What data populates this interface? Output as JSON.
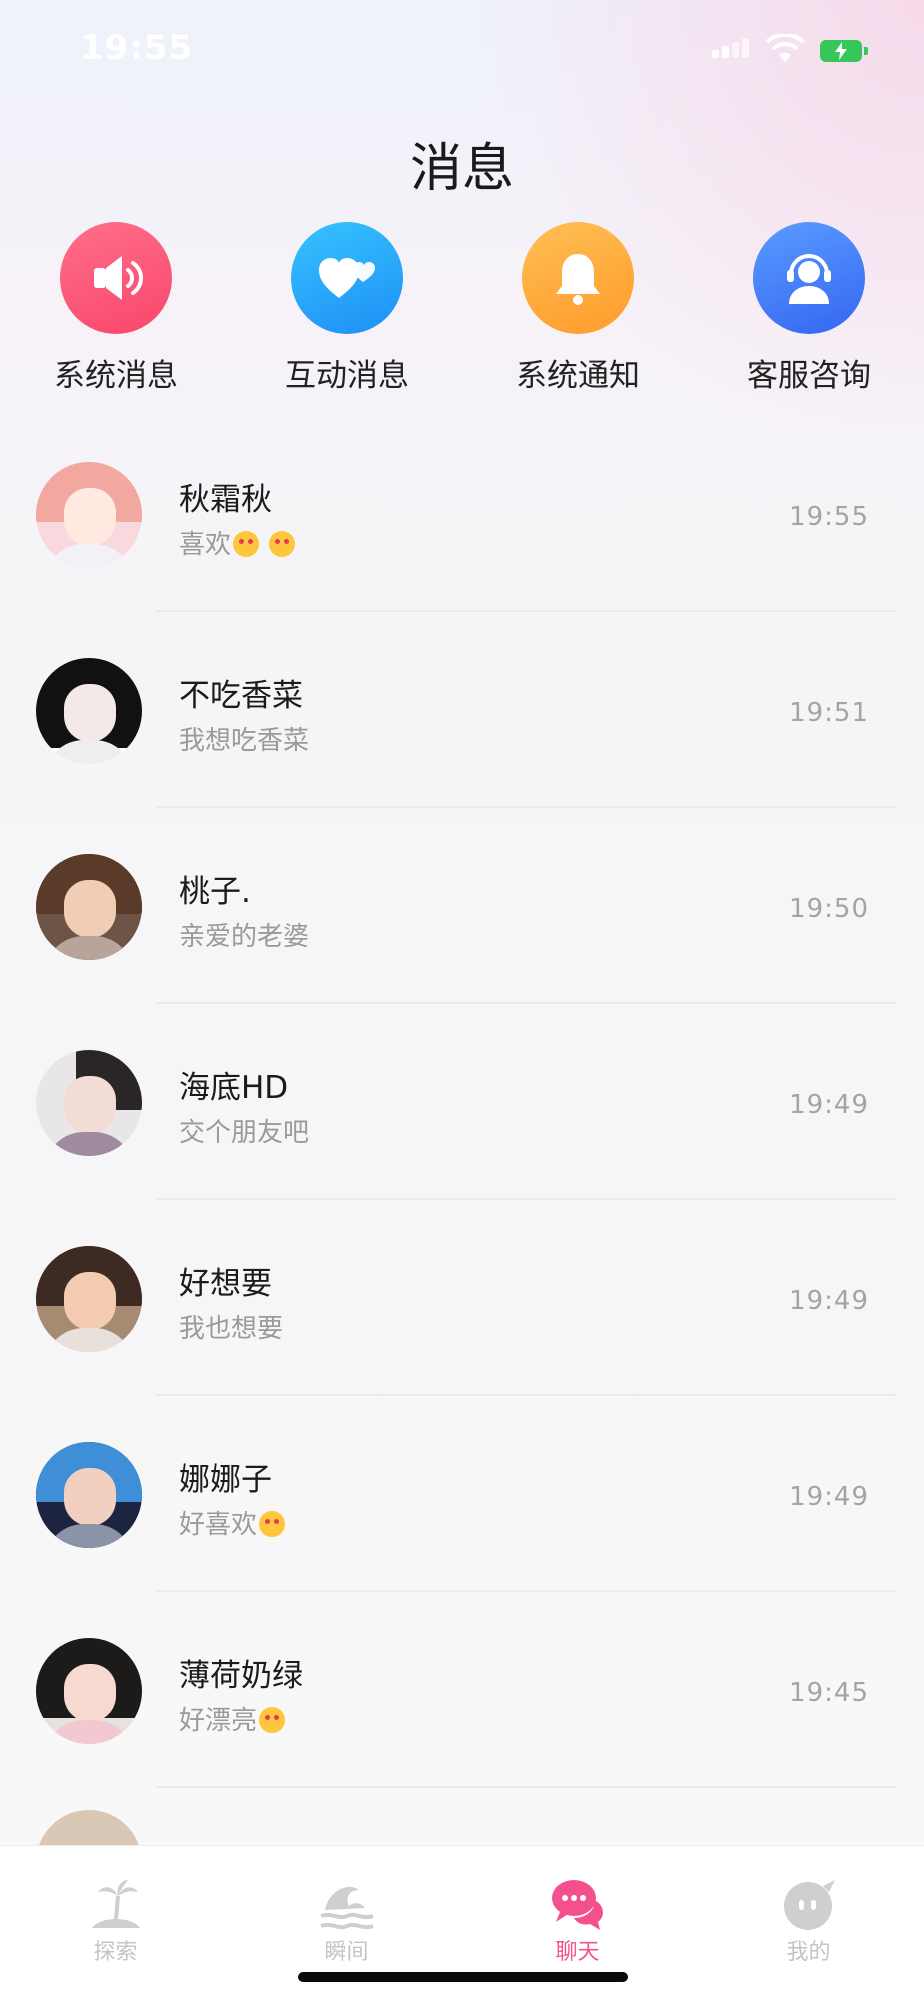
{
  "status_bar": {
    "time": "19:55"
  },
  "header": {
    "title": "消息"
  },
  "quick_actions": [
    {
      "label": "系统消息",
      "icon": "speaker-icon",
      "color": "#f9466b"
    },
    {
      "label": "互动消息",
      "icon": "hearts-icon",
      "color": "#1d8ff5"
    },
    {
      "label": "系统通知",
      "icon": "bell-icon",
      "color": "#ff9b2c"
    },
    {
      "label": "客服咨询",
      "icon": "headset-agent-icon",
      "color": "#3466f2"
    }
  ],
  "chats": [
    {
      "name": "秋霜秋",
      "message": "喜欢",
      "emoji": "kiss-heart-eyes-emoji",
      "time": "19:55"
    },
    {
      "name": "不吃香菜",
      "message": "我想吃香菜",
      "time": "19:51"
    },
    {
      "name": "桃子.",
      "message": "亲爱的老婆",
      "time": "19:50"
    },
    {
      "name": "海底HD",
      "message": "交个朋友吧",
      "time": "19:49"
    },
    {
      "name": "好想要",
      "message": "我也想要",
      "time": "19:49"
    },
    {
      "name": "娜娜子",
      "message": "好喜欢",
      "emoji": "heart-eyes-emoji",
      "time": "19:49"
    },
    {
      "name": "薄荷奶绿",
      "message": "好漂亮",
      "emoji": "heart-eyes-emoji",
      "time": "19:45"
    }
  ],
  "tab_bar": {
    "tabs": [
      {
        "label": "探索",
        "icon": "palm-island-icon"
      },
      {
        "label": "瞬间",
        "icon": "wave-icon"
      },
      {
        "label": "聊天",
        "icon": "chat-bubbles-icon",
        "active": true
      },
      {
        "label": "我的",
        "icon": "profile-bubble-icon"
      }
    ]
  },
  "colors": {
    "accent": "#f4508e",
    "muted_text": "#9a9a9a"
  }
}
